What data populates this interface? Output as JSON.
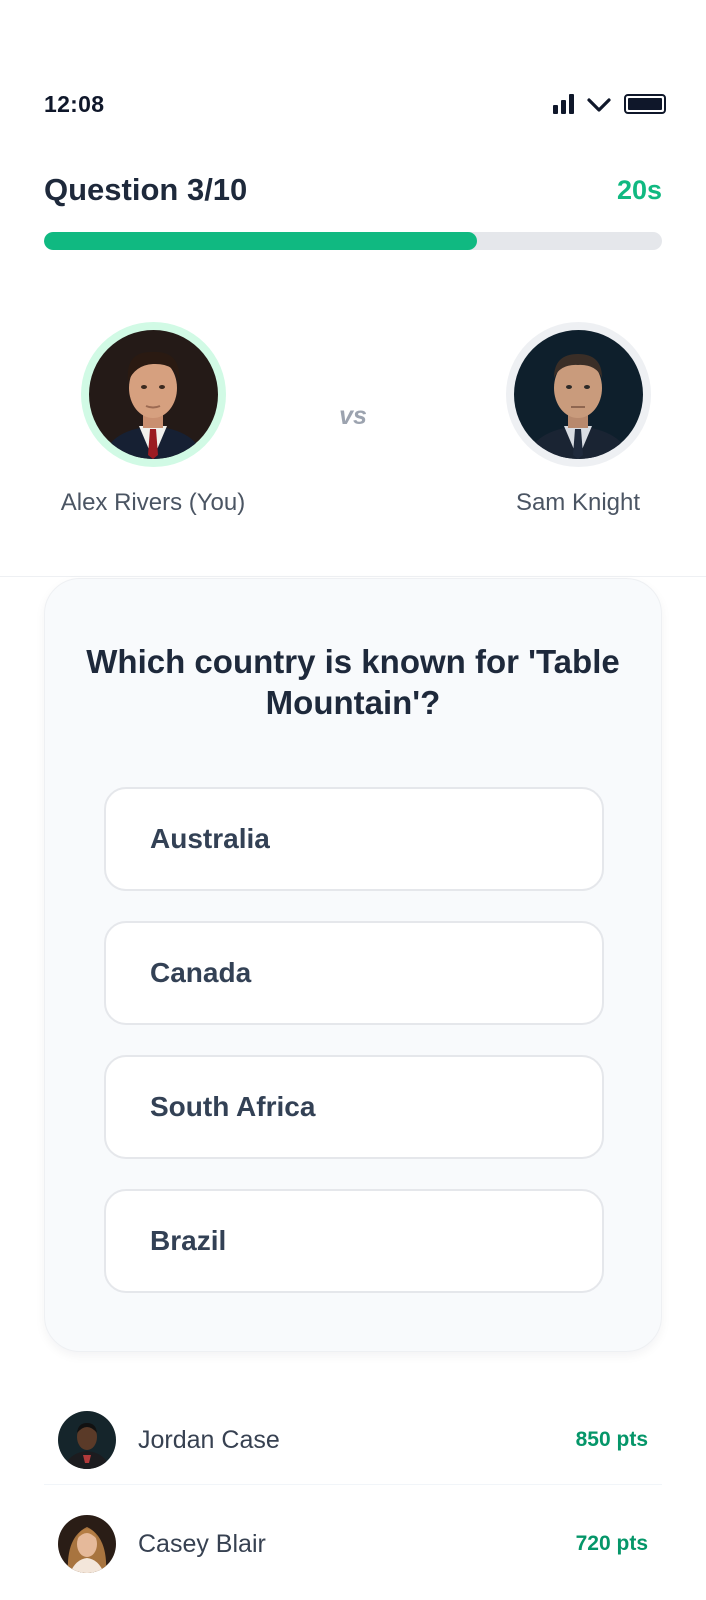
{
  "status_bar": {
    "time": "12:08",
    "icons": [
      "signal-icon",
      "wifi-icon",
      "battery-icon"
    ]
  },
  "quiz": {
    "question_counter": "Question 3/10",
    "timer": "20s",
    "progress_fraction": 0.7
  },
  "players": {
    "you": {
      "name": "Alex Rivers (You)",
      "avatar": "user-avatar"
    },
    "vs_label": "vs",
    "opponent": {
      "name": "Sam Knight",
      "avatar": "opponent-avatar"
    }
  },
  "question": {
    "text": "Which country is known for 'Table Mountain'?",
    "options": [
      "Australia",
      "Canada",
      "South Africa",
      "Brazil"
    ]
  },
  "leaderboard": [
    {
      "name": "Jordan Case",
      "points": "850 pts"
    },
    {
      "name": "Casey Blair",
      "points": "720 pts"
    }
  ],
  "colors": {
    "accent": "#10b981",
    "points": "#059669",
    "progress_track": "#e5e7eb",
    "card_background": "#f8fafc"
  }
}
